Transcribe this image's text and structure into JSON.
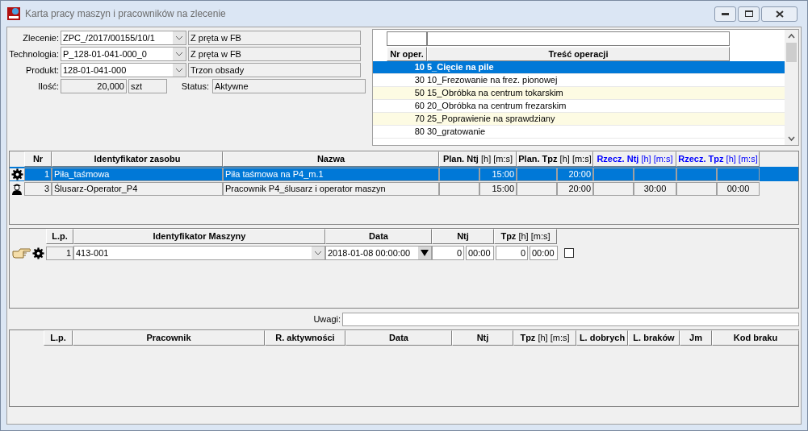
{
  "window": {
    "title": "Karta pracy maszyn i pracowników na zlecenie"
  },
  "order_form": {
    "fields": [
      {
        "label": "Zlecenie:",
        "value": "ZPC_/2017/00155/10/1",
        "description": "Z pręta w FB"
      },
      {
        "label": "Technologia:",
        "value": "P_128-01-041-000_0",
        "description": "Z pręta w FB"
      },
      {
        "label": "Produkt:",
        "value": "128-01-041-000",
        "description": "Trzon obsady"
      }
    ],
    "quantity": {
      "label": "Ilość:",
      "value": "20,000",
      "unit": "szt"
    },
    "status": {
      "label": "Status:",
      "value": "Aktywne"
    }
  },
  "operations": {
    "columns": [
      "Nr oper.",
      "Treść operacji"
    ],
    "rows": [
      {
        "nr": "10",
        "name": "5_Cięcie na pile",
        "selected": true
      },
      {
        "nr": "30",
        "name": "10_Frezowanie na frez. pionowej",
        "selected": false
      },
      {
        "nr": "50",
        "name": "15_Obróbka na centrum tokarskim",
        "selected": false
      },
      {
        "nr": "60",
        "name": "20_Obróbka na centrum frezarskim",
        "selected": false
      },
      {
        "nr": "70",
        "name": "25_Poprawienie na sprawdziany",
        "selected": false
      },
      {
        "nr": "80",
        "name": "30_gratowanie",
        "selected": false
      }
    ]
  },
  "resources": {
    "columns": [
      {
        "label": "Nr",
        "kind": "plain"
      },
      {
        "label": "Identyfikator zasobu",
        "kind": "plain"
      },
      {
        "label": "Nazwa",
        "kind": "plain"
      },
      {
        "label": "**Plan. Ntj** [h] [m:s]",
        "kind": "plan"
      },
      {
        "label": "**Plan. Tpz** [h] [m:s]",
        "kind": "plan"
      },
      {
        "label": "**Rzecz. Ntj** [h] [m:s]",
        "kind": "actual"
      },
      {
        "label": "**Rzecz. Tpz** [h] [m:s]",
        "kind": "actual"
      }
    ],
    "rows": [
      {
        "kind": "machine",
        "selected": true,
        "nr": "1",
        "id": "Piła_taśmowa",
        "name": "Piła taśmowa na P4_m.1",
        "plan_ntj_time": "15:00",
        "plan_tpz_time": "20:00"
      },
      {
        "kind": "worker",
        "selected": false,
        "nr": "3",
        "id": "Ślusarz-Operator_P4",
        "name": "Pracownik P4_ślusarz i operator maszyn",
        "plan_ntj_time": "15:00",
        "plan_tpz_time": "20:00",
        "actual_ntj_time": "30:00",
        "actual_tpz_time": "00:00"
      }
    ]
  },
  "machines": {
    "columns": [
      {
        "label": "L.p.",
        "kind": "plain"
      },
      {
        "label": "Identyfikator Maszyny",
        "kind": "plain"
      },
      {
        "label": "Data",
        "kind": "plain"
      },
      {
        "label": "Ntj",
        "kind": "plain"
      },
      {
        "label": "**Tpz** [h] [m:s]",
        "kind": "plan"
      }
    ],
    "rows": [
      {
        "current": true,
        "lp": "1",
        "machine": "413-001",
        "date": "2018-01-08 00:00:00",
        "ntj_hours": "0",
        "ntj_time": "00:00",
        "tpz_hours": "0",
        "tpz_time": "00:00",
        "checked": false
      }
    ]
  },
  "remarks": {
    "label": "Uwagi:"
  },
  "workers": {
    "columns": [
      {
        "label": "L.p.",
        "kind": "plain"
      },
      {
        "label": "Pracownik",
        "kind": "plain"
      },
      {
        "label": "R. aktywności",
        "kind": "plain"
      },
      {
        "label": "Data",
        "kind": "plain"
      },
      {
        "label": "Ntj",
        "kind": "plain"
      },
      {
        "label": "**Tpz** [h] [m:s]",
        "kind": "plan"
      },
      {
        "label": "L. dobrych",
        "kind": "plain"
      },
      {
        "label": "L. braków",
        "kind": "plain"
      },
      {
        "label": "Jm",
        "kind": "plain"
      },
      {
        "label": "Kod braku",
        "kind": "plain"
      }
    ]
  }
}
